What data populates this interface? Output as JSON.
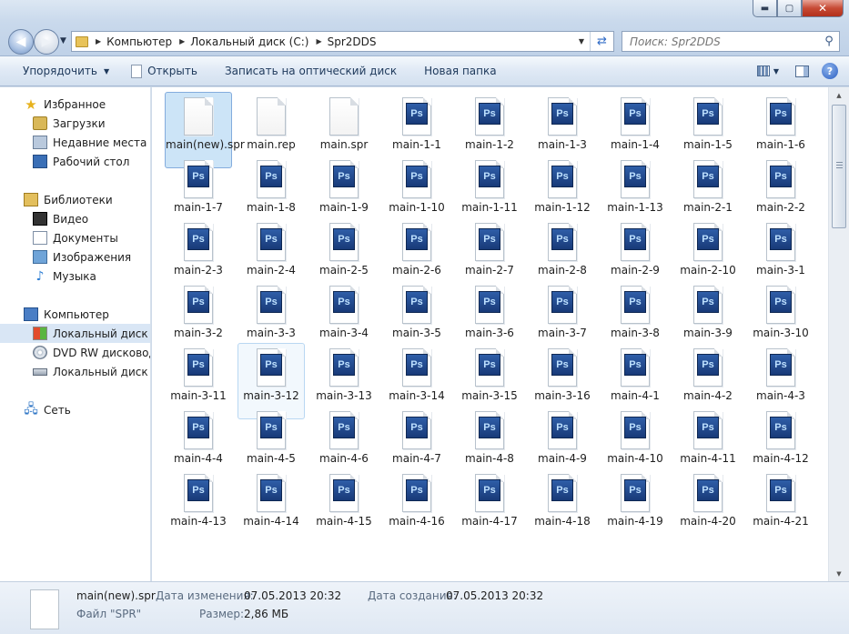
{
  "window": {
    "minimize_icon": "minimize-icon",
    "maximize_icon": "maximize-icon",
    "close_icon": "close-icon"
  },
  "address": {
    "crumbs": [
      "Компьютер",
      "Локальный диск (C:)",
      "Spr2DDS"
    ]
  },
  "search": {
    "placeholder": "Поиск: Spr2DDS"
  },
  "toolbar": {
    "organize": "Упорядочить",
    "open": "Открыть",
    "burn": "Записать на оптический диск",
    "new_folder": "Новая папка"
  },
  "nav": {
    "favorites": "Избранное",
    "downloads": "Загрузки",
    "recent": "Недавние места",
    "desktop": "Рабочий стол",
    "libraries": "Библиотеки",
    "video": "Видео",
    "documents": "Документы",
    "images": "Изображения",
    "music": "Музыка",
    "computer": "Компьютер",
    "local_c": "Локальный диск (C:)",
    "dvd": "DVD RW дисковод (",
    "local_k": "Локальный диск (K:)",
    "network": "Сеть"
  },
  "files": [
    "main(new).spr",
    "main.rep",
    "main.spr",
    "main-1-1",
    "main-1-2",
    "main-1-3",
    "main-1-4",
    "main-1-5",
    "main-1-6",
    "main-1-7",
    "main-1-8",
    "main-1-9",
    "main-1-10",
    "main-1-11",
    "main-1-12",
    "main-1-13",
    "main-2-1",
    "main-2-2",
    "main-2-3",
    "main-2-4",
    "main-2-5",
    "main-2-6",
    "main-2-7",
    "main-2-8",
    "main-2-9",
    "main-2-10",
    "main-3-1",
    "main-3-2",
    "main-3-3",
    "main-3-4",
    "main-3-5",
    "main-3-6",
    "main-3-7",
    "main-3-8",
    "main-3-9",
    "main-3-10",
    "main-3-11",
    "main-3-12",
    "main-3-13",
    "main-3-14",
    "main-3-15",
    "main-3-16",
    "main-4-1",
    "main-4-2",
    "main-4-3",
    "main-4-4",
    "main-4-5",
    "main-4-6",
    "main-4-7",
    "main-4-8",
    "main-4-9",
    "main-4-10",
    "main-4-11",
    "main-4-12",
    "main-4-13",
    "main-4-14",
    "main-4-15",
    "main-4-16",
    "main-4-17",
    "main-4-18",
    "main-4-19",
    "main-4-20",
    "main-4-21"
  ],
  "ps_label": "Ps",
  "details": {
    "name": "main(new).spr",
    "type": "Файл \"SPR\"",
    "modified_label": "Дата изменения:",
    "modified_value": "07.05.2013 20:32",
    "created_label": "Дата создания:",
    "created_value": "07.05.2013 20:32",
    "size_label": "Размер:",
    "size_value": "2,86 МБ"
  }
}
